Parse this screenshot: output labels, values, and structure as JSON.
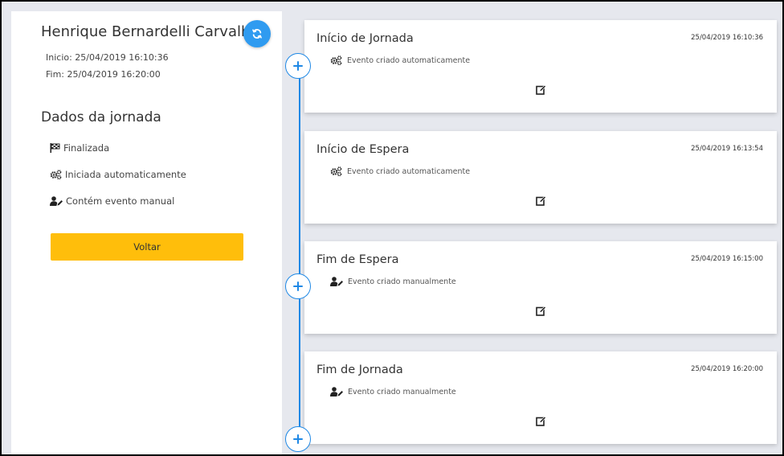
{
  "driver": {
    "name": "Henrique Bernardelli Carvalho",
    "inicio": "Inicio: 25/04/2019 16:10:36",
    "fim": "Fim: 25/04/2019 16:20:00"
  },
  "journey": {
    "section_title": "Dados da jornada",
    "statuses": [
      {
        "label": "Finalizada",
        "icon": "checkered-flag-icon"
      },
      {
        "label": "Iniciada automaticamente",
        "icon": "cogs-icon"
      },
      {
        "label": "Contém evento manual",
        "icon": "user-edit-icon"
      }
    ],
    "back_label": "Voltar"
  },
  "colors": {
    "accent_blue": "#1e88e5",
    "refresh_blue": "#2f9bf0",
    "back_button": "#ffbe0b"
  },
  "events": [
    {
      "title": "Início de Jornada",
      "time": "25/04/2019 16:10:36",
      "origin": "Evento criado automaticamente",
      "origin_icon": "cogs-icon"
    },
    {
      "title": "Início de Espera",
      "time": "25/04/2019 16:13:54",
      "origin": "Evento criado automaticamente",
      "origin_icon": "cogs-icon"
    },
    {
      "title": "Fim de Espera",
      "time": "25/04/2019 16:15:00",
      "origin": "Evento criado manualmente",
      "origin_icon": "user-edit-icon"
    },
    {
      "title": "Fim de Jornada",
      "time": "25/04/2019 16:20:00",
      "origin": "Evento criado manualmente",
      "origin_icon": "user-edit-icon"
    }
  ]
}
